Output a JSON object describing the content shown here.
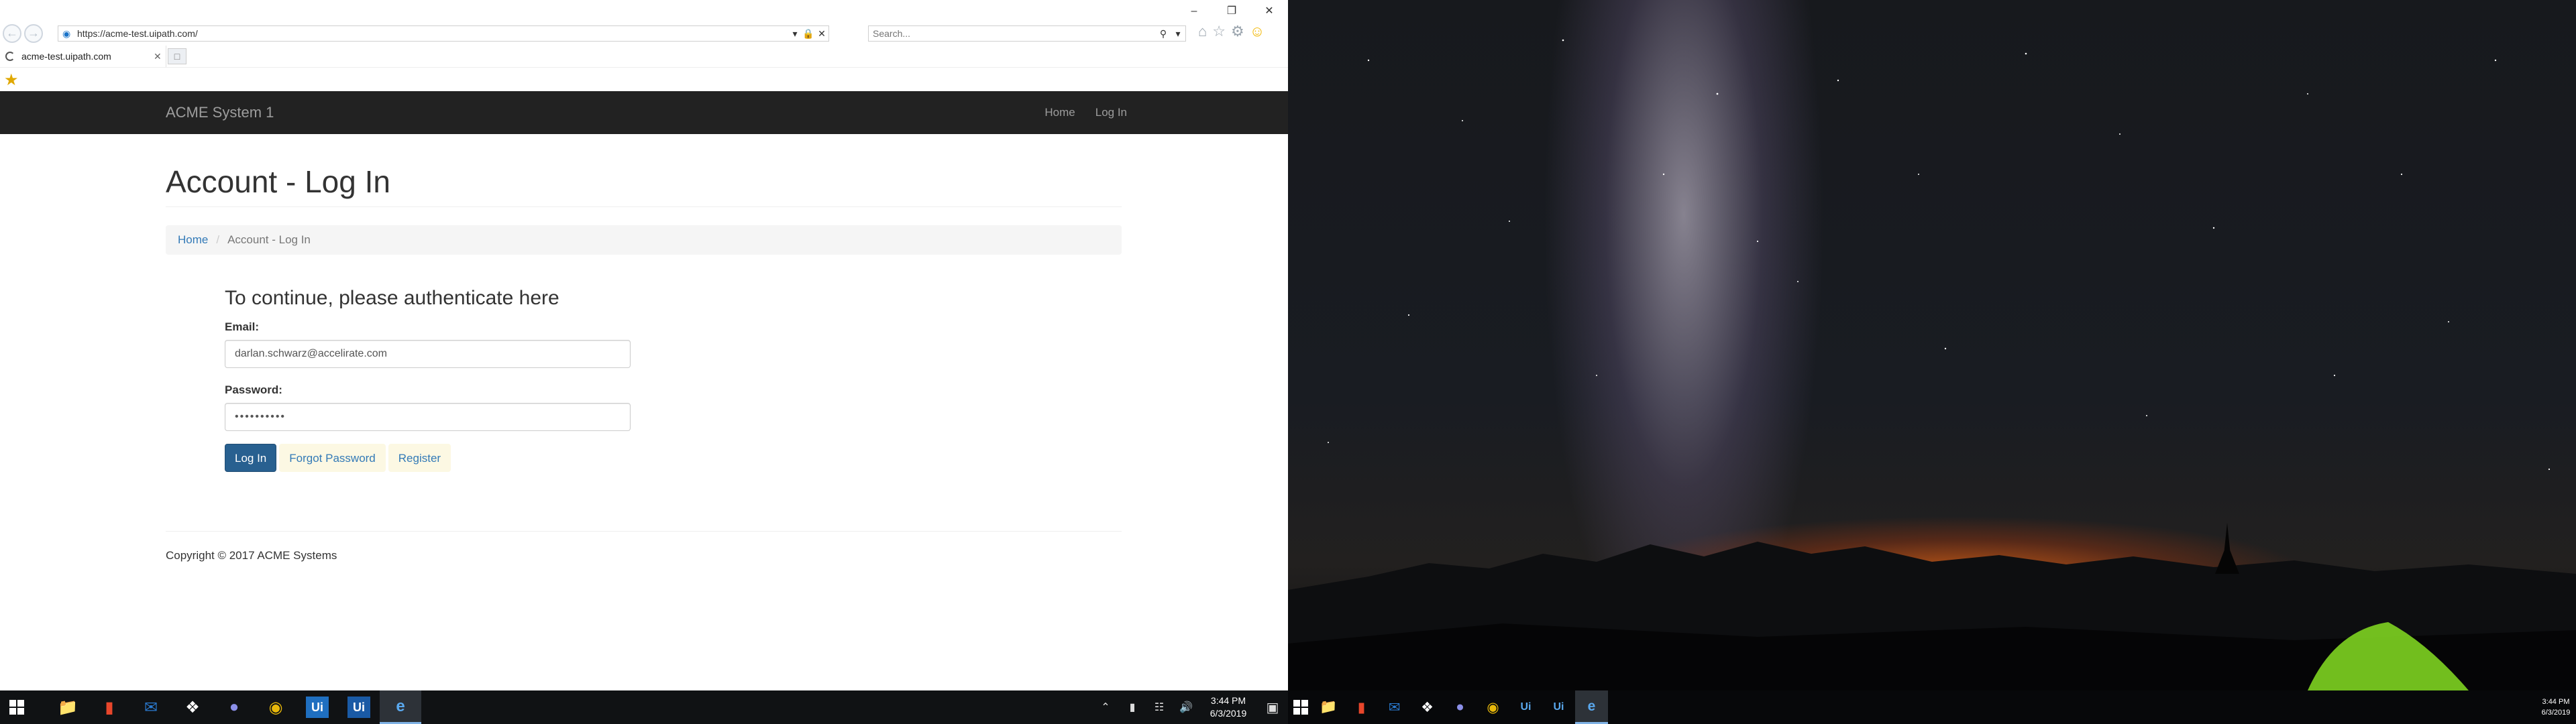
{
  "browser": {
    "address_url": "https://acme-test.uipath.com/",
    "search_placeholder": "Search...",
    "tab_title": "acme-test.uipath.com"
  },
  "site": {
    "brand": "ACME System 1",
    "nav": {
      "home": "Home",
      "login": "Log In"
    },
    "page_title": "Account - Log In",
    "breadcrumb": {
      "home": "Home",
      "current": "Account - Log In"
    },
    "form": {
      "title": "To continue, please authenticate here",
      "email_label": "Email:",
      "email_value": "darlan.schwarz@accelirate.com",
      "password_label": "Password:",
      "password_value": "••••••••••",
      "login_button": "Log In",
      "forgot_button": "Forgot Password",
      "register_button": "Register"
    },
    "footer": "Copyright © 2017 ACME Systems"
  },
  "taskbar_left": {
    "time": "3:44 PM",
    "date": "6/3/2019",
    "icons": [
      "windows-start",
      "file-explorer",
      "office",
      "outlook",
      "dropbox",
      "teams",
      "chrome",
      "uipath-studio",
      "uipath-robot",
      "internet-explorer"
    ]
  },
  "taskbar_right": {
    "time": "3:44 PM",
    "date": "6/3/2019"
  },
  "colors": {
    "navbar": "#222222",
    "primary_button": "#286090",
    "link": "#337ab7",
    "highlight_button_bg": "#fcf8e3"
  }
}
